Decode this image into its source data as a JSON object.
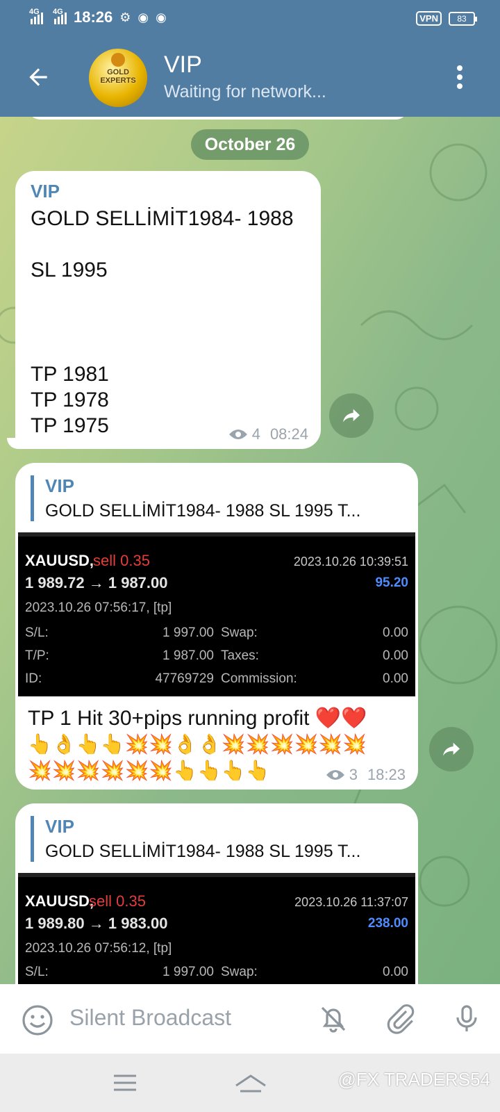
{
  "status_bar": {
    "network1": "4G",
    "network2": "4G",
    "time": "18:26",
    "vpn": "VPN",
    "battery": "83"
  },
  "header": {
    "title": "VIP",
    "subtitle": "Waiting for network...",
    "avatar_text": "GOLD EXPERTS"
  },
  "chat": {
    "date_separator": "October 26",
    "messages": [
      {
        "sender": "VIP",
        "lines": [
          "GOLD SELLİMİT1984- 1988",
          "SL 1995",
          "TP 1981",
          "TP 1978",
          "TP 1975"
        ],
        "views": "4",
        "time": "08:24"
      },
      {
        "reply_name": "VIP",
        "reply_text": "GOLD SELLİMİT1984- 1988  SL 1995     T...",
        "trade": {
          "symbol": "XAUUSD,",
          "side": "sell 0.35",
          "date": "2023.10.26 10:39:51",
          "prices": "1 989.72 → 1 987.00",
          "profit": "95.20",
          "opened": "2023.10.26 07:56:17, [tp]",
          "rows": [
            {
              "k1": "S/L:",
              "v1": "1 997.00",
              "k2": "Swap:",
              "v2": "0.00"
            },
            {
              "k1": "T/P:",
              "v1": "1 987.00",
              "k2": "Taxes:",
              "v2": "0.00"
            },
            {
              "k1": "ID:",
              "v1": "47769729",
              "k2": "Commission:",
              "v2": "0.00"
            }
          ]
        },
        "caption": "TP 1 Hit 30+pips running profit ❤️❤️",
        "emoji_line1": "👆👌👆👆💥💥👌👌💥💥💥💥💥💥",
        "emoji_line2": "💥💥💥💥💥💥👆👆👆👆",
        "views": "3",
        "time": "18:23"
      },
      {
        "reply_name": "VIP",
        "reply_text": "GOLD SELLİMİT1984- 1988  SL 1995     T...",
        "trade": {
          "symbol": "XAUUSD,",
          "side": "sell 0.35",
          "date": "2023.10.26 11:37:07",
          "prices": "1 989.80 → 1 983.00",
          "profit": "238.00",
          "opened": "2023.10.26 07:56:12, [tp]",
          "rows": [
            {
              "k1": "S/L:",
              "v1": "1 997.00",
              "k2": "Swap:",
              "v2": "0.00"
            }
          ]
        }
      }
    ]
  },
  "input_bar": {
    "placeholder": "Silent Broadcast"
  },
  "watermark": "@FX TRADERS54",
  "icons": [
    "back-arrow-icon",
    "more-vert-icon",
    "eye-icon",
    "forward-icon",
    "emoji-icon",
    "bell-off-icon",
    "attach-icon",
    "mic-icon",
    "menu-icon",
    "home-icon"
  ]
}
